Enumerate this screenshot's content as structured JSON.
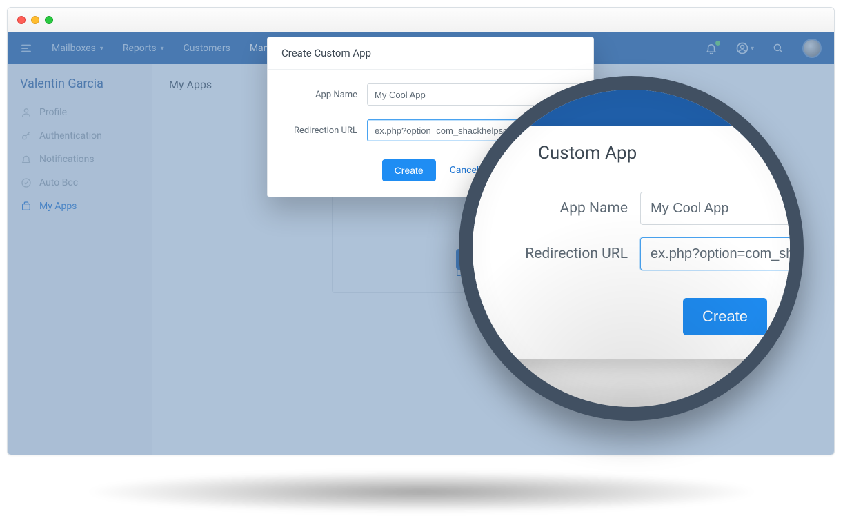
{
  "nav": {
    "mailboxes": "Mailboxes",
    "reports": "Reports",
    "customers": "Customers",
    "manage": "Manage"
  },
  "sidebar": {
    "user_name": "Valentin Garcia",
    "items": [
      {
        "label": "Profile"
      },
      {
        "label": "Authentication"
      },
      {
        "label": "Notifications"
      },
      {
        "label": "Auto Bcc"
      },
      {
        "label": "My Apps"
      }
    ]
  },
  "page": {
    "title": "My Apps",
    "learn_more": "Learn more"
  },
  "modal": {
    "title": "Create Custom App",
    "app_name_label": "App Name",
    "app_name_value": "My Cool App",
    "redirect_label": "Redirection URL",
    "redirect_value": "ex.php?option=com_shackhelpscout&task=authen",
    "create_label": "Create",
    "cancel_label": "Cancel"
  },
  "magnifier": {
    "title": "Custom App",
    "app_name_label": "App Name",
    "app_name_value": "My Cool App",
    "redirect_label": "Redirection URL",
    "redirect_value": "ex.php?option=com_sha",
    "create_label": "Create"
  }
}
